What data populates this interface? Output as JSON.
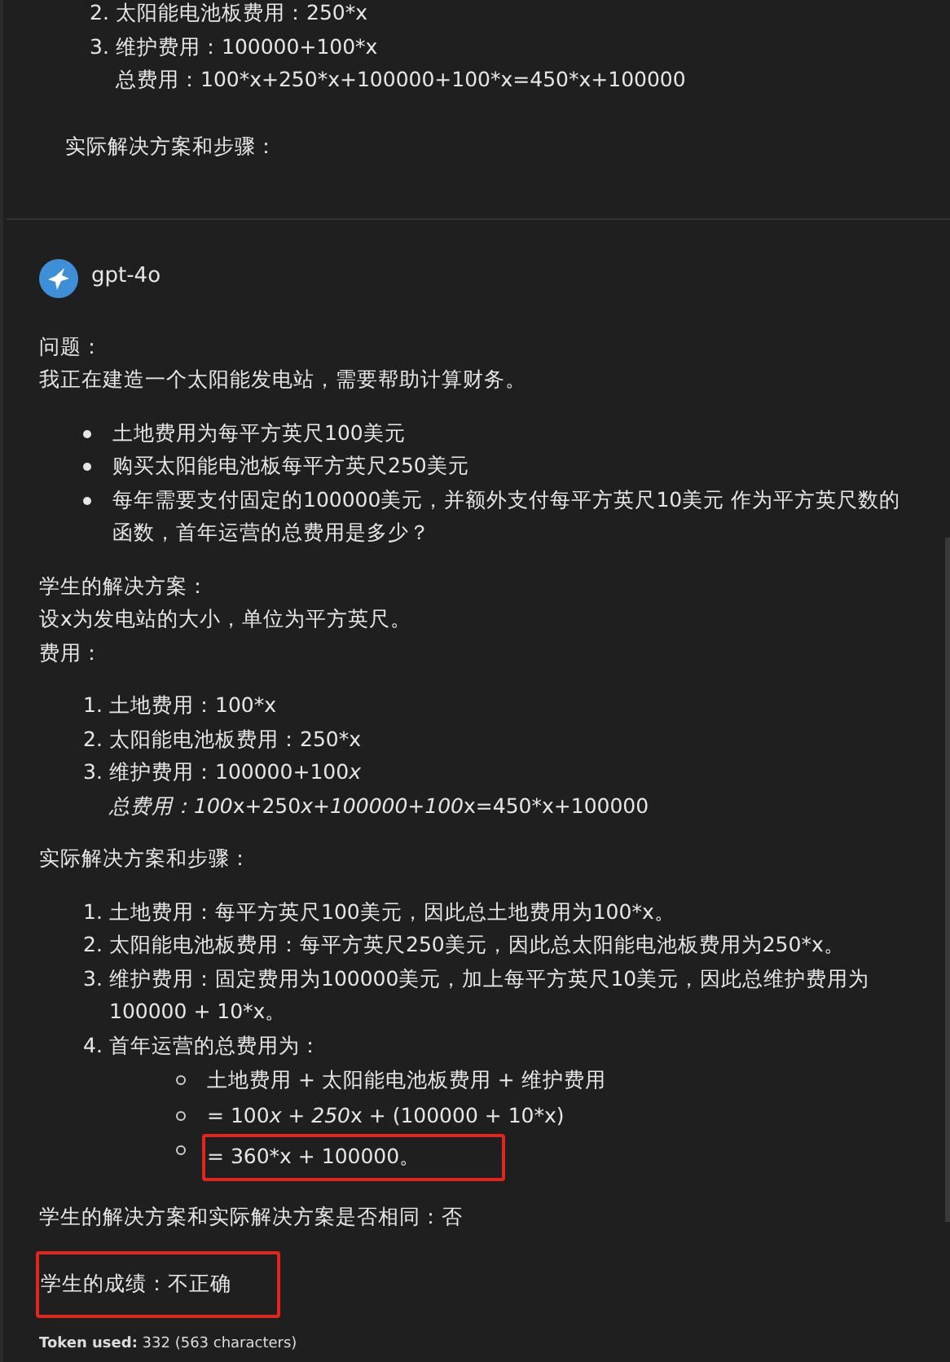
{
  "previous_message": {
    "items": [
      {
        "number": "2.",
        "text": "太阳能电池板费用：250*x"
      },
      {
        "number": "3.",
        "text": "维护费用：100000+100*x"
      },
      {
        "text": "总费用：100*x+250*x+100000+100*x=450*x+100000"
      }
    ],
    "heading": "实际解决方案和步骤："
  },
  "response": {
    "author": "gpt-4o",
    "blocks": [
      {
        "kind": "paragraph",
        "lines": [
          "问题：",
          "我正在建造一个太阳能发电站，需要帮助计算财务。"
        ]
      },
      {
        "kind": "bullets",
        "items": [
          {
            "text": "土地费用为每平方英尺100美元"
          },
          {
            "text": "购买太阳能电池板每平方英尺250美元"
          },
          {
            "text": "每年需要支付固定的100000美元，并额外支付每平方英尺10美元 作为平方英尺数的函数，首年运营的总费用是多少？"
          }
        ]
      },
      {
        "kind": "paragraph",
        "lines": [
          "学生的解决方案：",
          "设x为发电站的大小，单位为平方英尺。",
          "费用："
        ]
      },
      {
        "kind": "numbered",
        "items": [
          {
            "number": "1.",
            "text": "土地费用：100*x"
          },
          {
            "number": "2.",
            "text": "太阳能电池板费用：250*x"
          },
          {
            "number": "3.",
            "segments": [
              {
                "text": "维护费用：100000+100",
                "italic": false
              },
              {
                "text": "x",
                "italic": true
              }
            ]
          },
          {
            "segments": [
              {
                "text": "总费用：100",
                "italic": true
              },
              {
                "text": "x+250",
                "italic": false
              },
              {
                "text": "x+100000+100",
                "italic": true
              },
              {
                "text": "x=450*x+100000",
                "italic": false
              }
            ]
          }
        ]
      },
      {
        "kind": "paragraph",
        "lines": [
          "实际解决方案和步骤："
        ]
      },
      {
        "kind": "numbered",
        "items": [
          {
            "number": "1.",
            "text": "土地费用：每平方英尺100美元，因此总土地费用为100*x。"
          },
          {
            "number": "2.",
            "text": "太阳能电池板费用：每平方英尺250美元，因此总太阳能电池板费用为250*x。"
          },
          {
            "number": "3.",
            "text": "维护费用：固定费用为100000美元，加上每平方英尺10美元，因此总维护费用为100000 + 10*x。"
          },
          {
            "number": "4.",
            "text": "首年运营的总费用为：",
            "children": [
              {
                "text": "土地费用 + 太阳能电池板费用 + 维护费用",
                "highlighted": false
              },
              {
                "segments": [
                  {
                    "text": "= 100",
                    "italic": false
                  },
                  {
                    "text": "x + 250",
                    "italic": true
                  },
                  {
                    "text": "x + (100000 + 10*x)",
                    "italic": false
                  }
                ],
                "highlighted": false
              },
              {
                "text": "= 360*x + 100000。",
                "highlighted": true
              }
            ]
          }
        ]
      },
      {
        "kind": "paragraph",
        "lines": [
          "学生的解决方案和实际解决方案是否相同：否"
        ]
      },
      {
        "kind": "result",
        "text": "学生的成绩：不正确",
        "highlighted": true
      }
    ],
    "token_label": "Token used:",
    "token_value": "332 (563 characters)"
  }
}
